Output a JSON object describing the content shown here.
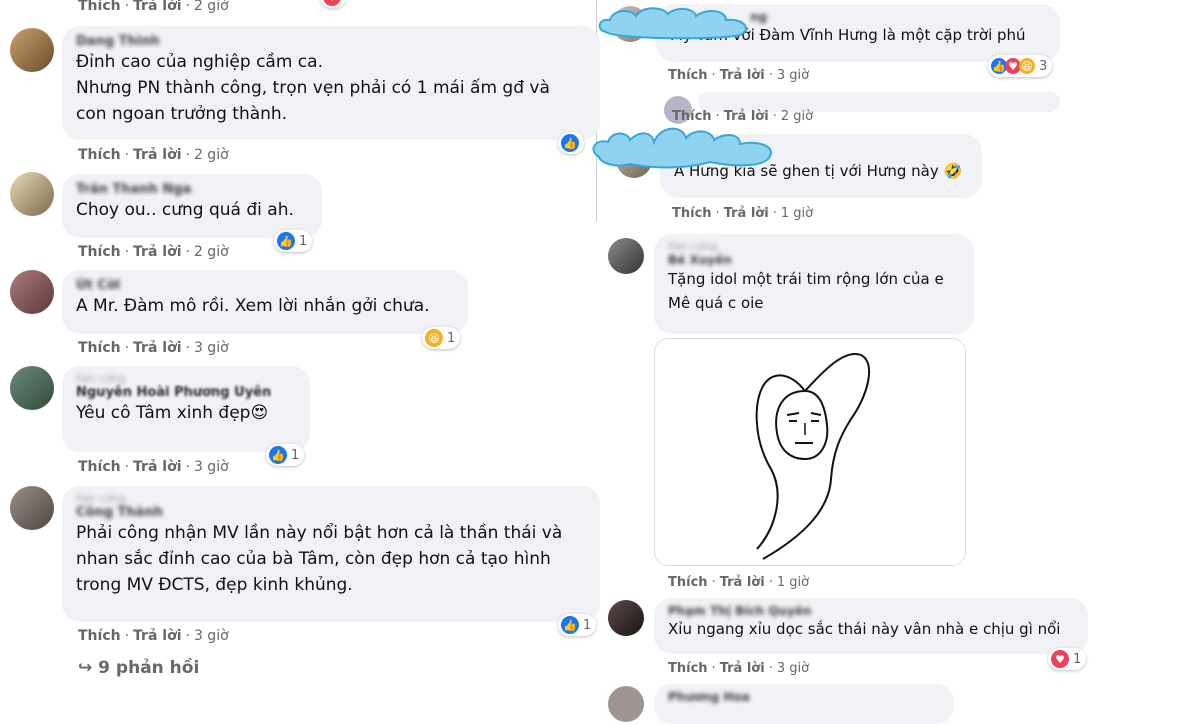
{
  "left": {
    "top_actions": {
      "like": "Thích",
      "reply": "Trả lời",
      "time": "2 giờ"
    },
    "comments": [
      {
        "author": "Dang Thinh",
        "text": "Đỉnh cao của nghiệp cầm ca.\nNhưng PN thành công, trọn vẹn phải có 1 mái ấm gđ và\ncon ngoan trưởng thành.",
        "like": "Thích",
        "reply": "Trả lời",
        "time": "2 giờ",
        "reaction_count": ""
      },
      {
        "author": "Trần Thanh Nga",
        "text": "Choy ou.. cưng quá đi ah.",
        "like": "Thích",
        "reply": "Trả lời",
        "time": "2 giờ",
        "reaction_count": "1"
      },
      {
        "author": "Út Cời",
        "text": "A Mr. Đàm mô rồi. Xem lời nhắn gởi chưa.",
        "like": "Thích",
        "reply": "Trả lời",
        "time": "3 giờ",
        "reaction_count": "1"
      },
      {
        "author_top": "Fan cứng",
        "author": "Nguyễn Hoài Phương Uyên",
        "text": "Yêu cô Tâm xinh đẹp😍",
        "like": "Thích",
        "reply": "Trả lời",
        "time": "3 giờ",
        "reaction_count": "1"
      },
      {
        "author_top": "Fan cứng",
        "author": "Công Thành",
        "text": "Phải công nhận MV lần này nổi bật hơn cả là thần thái và\nnhan sắc đỉnh cao của bà Tâm, còn đẹp hơn cả tạo hình\ntrong MV ĐCTS, đẹp kinh khủng.",
        "like": "Thích",
        "reply": "Trả lời",
        "time": "3 giờ",
        "reaction_count": "1"
      }
    ],
    "replies_label": "9 phản hồi"
  },
  "right": {
    "comments": [
      {
        "author": "ng",
        "text": "Mỹ Tâm với Đàm Vĩnh Hưng là một cặp trời phú",
        "like": "Thích",
        "reply": "Trả lời",
        "time": "3 giờ",
        "reaction_count": "3"
      },
      {
        "author": "",
        "text": "",
        "like": "Thích",
        "reply": "Trả lời",
        "time": "2 giờ"
      },
      {
        "author": "",
        "text": "A Hưng kia sẽ ghen tị với Hưng này 🤣",
        "like": "Thích",
        "reply": "Trả lời",
        "time": "1 giờ"
      },
      {
        "author_top": "Fan cứng",
        "author": "Bé Xuyến",
        "text": "Tặng idol một trái tim rộng lớn của e\nMê quá c oie",
        "like": "Thích",
        "reply": "Trả lời",
        "time": "1 giờ"
      },
      {
        "author": "Phạm Thị Bích Quyên",
        "text": "Xỉu ngang xỉu dọc sắc thái này vân nhà e chịu gì nổi",
        "like": "Thích",
        "reply": "Trả lời",
        "time": "3 giờ",
        "reaction_count": "1"
      },
      {
        "author": "Phương Hoa"
      }
    ]
  },
  "colors": {
    "like": "#1877f2",
    "love": "#f33e58",
    "haha": "#f7b125",
    "bubble": "#f0f2f5",
    "cloud": "#8fd3f0"
  }
}
